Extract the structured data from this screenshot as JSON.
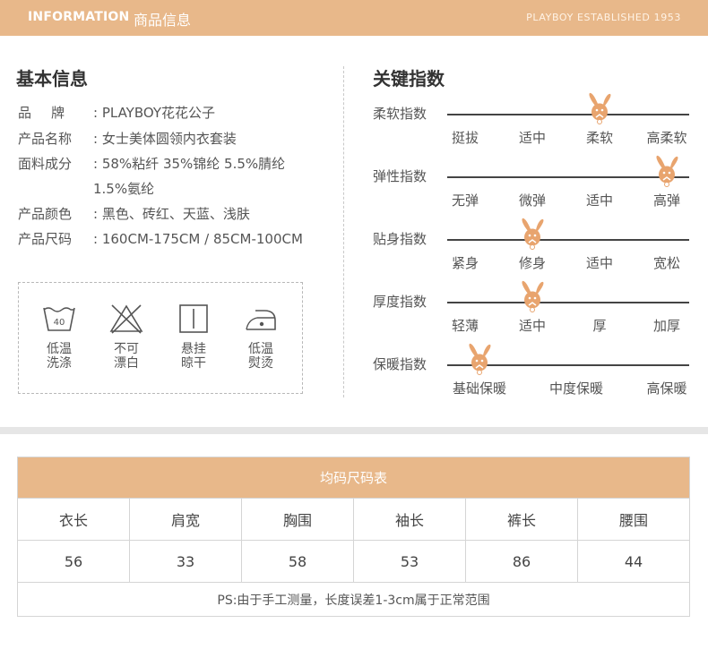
{
  "header": {
    "en_title": "INFORMATION",
    "cn_title": "商品信息",
    "established": "PLAYBOY ESTABLISHED 1953"
  },
  "basic_info": {
    "title": "基本信息",
    "rows": [
      {
        "key": "品牌",
        "sep": ":",
        "value": "PLAYBOY花花公子"
      },
      {
        "key": "产品名称",
        "sep": ":",
        "value": "女士美体圆领内衣套装"
      },
      {
        "key": "面料成分",
        "sep": ":",
        "value": "58%粘纤 35%锦纶 5.5%腈纶"
      },
      {
        "key": "",
        "sep": "",
        "value": "1.5%氨纶"
      },
      {
        "key": "产品颜色",
        "sep": ":",
        "value": "黑色、砖红、天蓝、浅肤"
      },
      {
        "key": "产品尺码",
        "sep": ":",
        "value": "160CM-175CM / 85CM-100CM"
      }
    ]
  },
  "care": {
    "items": [
      {
        "icon": "wash-40-icon",
        "wash_temp": "40",
        "label_1": "低温",
        "label_2": "洗涤"
      },
      {
        "icon": "no-bleach-icon",
        "label_1": "不可",
        "label_2": "漂白"
      },
      {
        "icon": "hang-dry-icon",
        "label_1": "悬挂",
        "label_2": "晾干"
      },
      {
        "icon": "low-iron-icon",
        "label_1": "低温",
        "label_2": "熨烫"
      }
    ]
  },
  "key_index": {
    "title": "关键指数",
    "accent_color": "#e8a46e",
    "indexes": [
      {
        "label": "柔软指数",
        "options": [
          "挺拔",
          "适中",
          "柔软",
          "高柔软"
        ],
        "selected": 2
      },
      {
        "label": "弹性指数",
        "options": [
          "无弹",
          "微弹",
          "适中",
          "高弹"
        ],
        "selected": 3
      },
      {
        "label": "贴身指数",
        "options": [
          "紧身",
          "修身",
          "适中",
          "宽松"
        ],
        "selected": 1
      },
      {
        "label": "厚度指数",
        "options": [
          "轻薄",
          "适中",
          "厚",
          "加厚"
        ],
        "selected": 1
      },
      {
        "label": "保暖指数",
        "options": [
          "基础保暖",
          "中度保暖",
          "高保暖"
        ],
        "selected": 0
      }
    ]
  },
  "size_table": {
    "caption": "均码尺码表",
    "headers": [
      "衣长",
      "肩宽",
      "胸围",
      "袖长",
      "裤长",
      "腰围"
    ],
    "values": [
      "56",
      "33",
      "58",
      "53",
      "86",
      "44"
    ],
    "note": "PS:由于手工测量，长度误差1-3cm属于正常范围"
  },
  "colors": {
    "accent": "#e8b88a",
    "bunny": "#e8a46e"
  }
}
